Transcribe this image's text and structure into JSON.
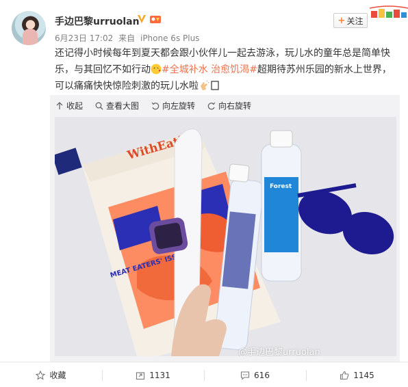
{
  "user": {
    "name": "手边巴黎urruolan",
    "follow_label": "关注"
  },
  "meta": {
    "date": "6月23日 17:02",
    "source_prefix": "来自",
    "source": "iPhone 6s Plus"
  },
  "post": {
    "text_part1": "还记得小时候每年到夏天都会跟小伙伴儿一起去游泳，玩儿水的童年总是简单快乐，与其回忆不如行动",
    "hashtag": "#全城补水 治愈饥渴#",
    "text_part2": "超期待苏州乐园的新水上世界，可以痛痛快快惊险刺激的玩儿水啦"
  },
  "media_toolbar": {
    "collapse": "收起",
    "view_large": "查看大图",
    "rotate_left": "向左旋转",
    "rotate_right": "向右旋转"
  },
  "photo": {
    "magazine_title": "WithEati",
    "magazine_text": "MEAT EATERS' ISSUE",
    "bottle_brand": "Forest",
    "watermark": "@手边巴黎urruolan"
  },
  "actions": {
    "favorite": "收藏",
    "repost": "1131",
    "comment": "616",
    "like": "1145"
  },
  "colors": {
    "hashtag": "#eb7350",
    "accent": "#ff8140"
  }
}
